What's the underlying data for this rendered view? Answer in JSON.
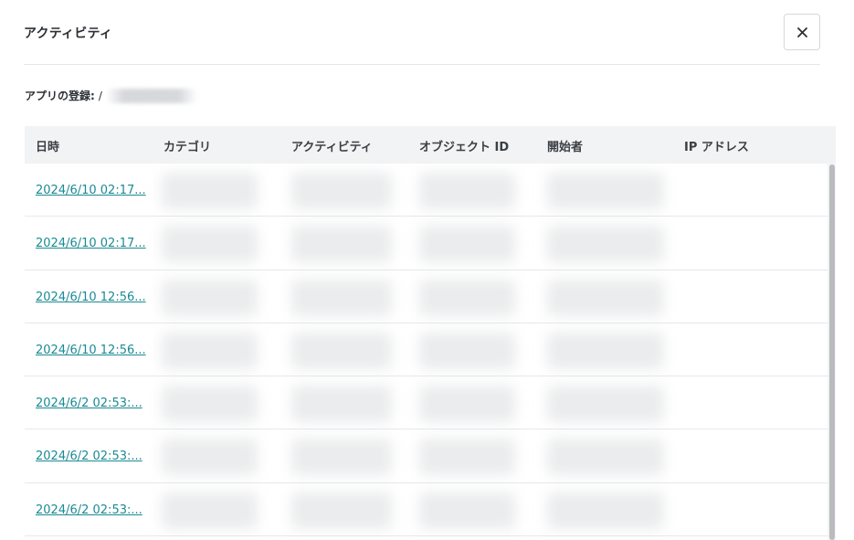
{
  "panel": {
    "title": "アクティビティ",
    "close_icon": "close-icon"
  },
  "app_registration": {
    "label": "アプリの登録:",
    "value_visible": "/"
  },
  "table": {
    "columns": [
      "日時",
      "カテゴリ",
      "アクティビティ",
      "オブジェクト ID",
      "開始者",
      "IP アドレス"
    ],
    "rows": [
      {
        "datetime": "2024/6/10 02:17..."
      },
      {
        "datetime": "2024/6/10 02:17..."
      },
      {
        "datetime": "2024/6/10 12:56..."
      },
      {
        "datetime": "2024/6/10 12:56..."
      },
      {
        "datetime": "2024/6/2 02:53:..."
      },
      {
        "datetime": "2024/6/2 02:53:..."
      },
      {
        "datetime": "2024/6/2 02:53:..."
      }
    ]
  },
  "colors": {
    "link": "#1a8a93",
    "header_bg": "#f2f3f5",
    "divider": "#e6e8eb"
  }
}
